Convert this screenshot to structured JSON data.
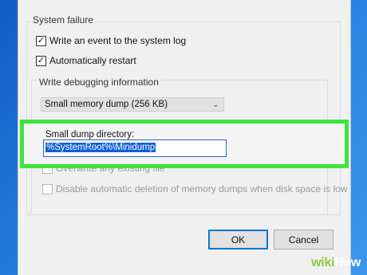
{
  "system_failure": {
    "group_label": "System failure",
    "write_event": {
      "label": "Write an event to the system log",
      "checked": true
    },
    "auto_restart": {
      "label": "Automatically restart",
      "checked": true
    }
  },
  "debugging": {
    "group_label": "Write debugging information",
    "selected_option": "Small memory dump (256 KB)",
    "dump_dir_label": "Small dump directory:",
    "dump_dir_value": "%SystemRoot%\\Minidump",
    "overwrite": {
      "label": "Overwrite any existing file",
      "checked": false,
      "enabled": false
    },
    "disable_auto_delete": {
      "label": "Disable automatic deletion of memory dumps when disk space is low",
      "checked": false,
      "enabled": false
    }
  },
  "buttons": {
    "ok": "OK",
    "cancel": "Cancel"
  },
  "watermark": {
    "wiki": "wiki",
    "how": "How"
  },
  "colors": {
    "highlight": "#3de43d",
    "selection": "#0f5fd9",
    "desktop": "#1e6fcf"
  }
}
